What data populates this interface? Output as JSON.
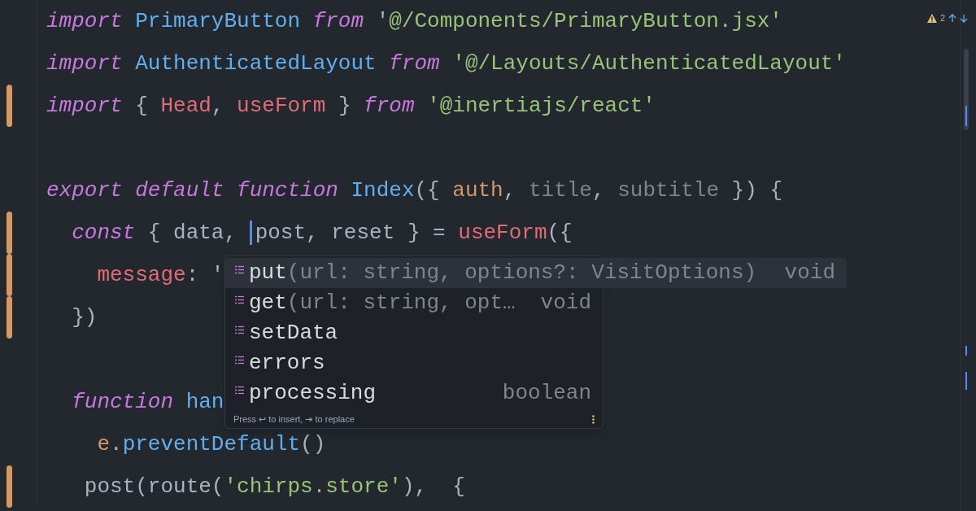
{
  "editor": {
    "lines": [
      {
        "modified": false,
        "tokens": [
          {
            "t": "import ",
            "kind": "kw"
          },
          {
            "t": "PrimaryButton ",
            "kind": "fn"
          },
          {
            "t": "from ",
            "kind": "kw"
          },
          {
            "t": "'@/Components/PrimaryButton.jsx'",
            "kind": "str"
          }
        ]
      },
      {
        "modified": false,
        "tokens": [
          {
            "t": "import ",
            "kind": "kw"
          },
          {
            "t": "AuthenticatedLayout ",
            "kind": "fn"
          },
          {
            "t": "from ",
            "kind": "kw"
          },
          {
            "t": "'@/Layouts/AuthenticatedLayout'",
            "kind": "str"
          }
        ]
      },
      {
        "modified": true,
        "tokens": [
          {
            "t": "import ",
            "kind": "kw"
          },
          {
            "t": "{ ",
            "kind": "plain"
          },
          {
            "t": "Head",
            "kind": "var"
          },
          {
            "t": ", ",
            "kind": "plain"
          },
          {
            "t": "useForm",
            "kind": "var"
          },
          {
            "t": " } ",
            "kind": "plain"
          },
          {
            "t": "from ",
            "kind": "kw"
          },
          {
            "t": "'@inertiajs/react'",
            "kind": "str"
          }
        ]
      },
      {
        "modified": false
      },
      {
        "modified": false,
        "tokens": [
          {
            "t": "export default function ",
            "kind": "kw"
          },
          {
            "t": "Index",
            "kind": "fn"
          },
          {
            "t": "({ ",
            "kind": "plain"
          },
          {
            "t": "auth",
            "kind": "param"
          },
          {
            "t": ", ",
            "kind": "plain"
          },
          {
            "t": "title",
            "kind": "dim"
          },
          {
            "t": ", ",
            "kind": "plain"
          },
          {
            "t": "subtitle",
            "kind": "dim"
          },
          {
            "t": " }) {",
            "kind": "plain"
          }
        ]
      },
      {
        "modified": true,
        "tokens": [
          {
            "t": "  const ",
            "kind": "kw"
          },
          {
            "t": "{ data, ",
            "kind": "plain"
          },
          {
            "t": "post, reset } = ",
            "kind": "plain",
            "cursor": true
          },
          {
            "t": "useForm",
            "kind": "var"
          },
          {
            "t": "({",
            "kind": "plain"
          }
        ]
      },
      {
        "modified": true,
        "tokens": [
          {
            "t": "    message",
            "kind": "var"
          },
          {
            "t": ": '",
            "kind": "plain"
          }
        ]
      },
      {
        "modified": true,
        "tokens": [
          {
            "t": "  })",
            "kind": "plain"
          }
        ]
      },
      {
        "modified": false
      },
      {
        "modified": false,
        "tokens": [
          {
            "t": "  function ",
            "kind": "kw"
          },
          {
            "t": "han",
            "kind": "fn"
          }
        ]
      },
      {
        "modified": false,
        "tokens": [
          {
            "t": "    e",
            "kind": "param"
          },
          {
            "t": ".",
            "kind": "plain"
          },
          {
            "t": "preventDefault",
            "kind": "fn"
          },
          {
            "t": "()",
            "kind": "plain"
          }
        ]
      },
      {
        "modified": true,
        "tokens": [
          {
            "t": "   post(route(",
            "kind": "plain"
          },
          {
            "t": "'chirps.store'",
            "kind": "str"
          },
          {
            "t": "),  {",
            "kind": "plain"
          }
        ]
      }
    ]
  },
  "problems": {
    "warnings": "2"
  },
  "completion": {
    "items": [
      {
        "label": "put",
        "signature": "(url: string, options?: VisitOptions)",
        "type": "void",
        "selected": true
      },
      {
        "label": "get",
        "signature": "(url: string, opt…",
        "type": "void",
        "selected": false
      },
      {
        "label": "setData",
        "selected": false
      },
      {
        "label": "errors",
        "selected": false
      },
      {
        "label": "processing",
        "type": "boolean",
        "selected": false
      }
    ],
    "hint": "Press ↩ to insert, ⇥ to replace"
  }
}
